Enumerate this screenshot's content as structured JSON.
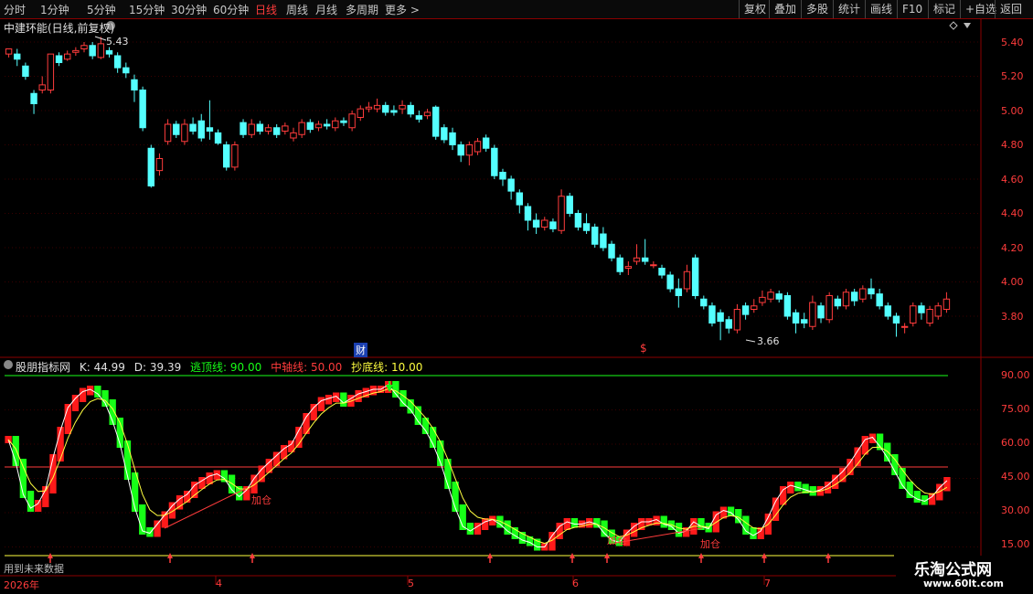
{
  "toolbar": {
    "periods": [
      "分时",
      "1分钟",
      "5分钟",
      "15分钟",
      "30分钟",
      "60分钟",
      "日线",
      "周线",
      "月线",
      "多周期",
      "更多 >"
    ],
    "active": "日线",
    "right_buttons": [
      "复权",
      "叠加",
      "多股",
      "统计",
      "画线",
      "F10",
      "标记",
      "+自选",
      "返回"
    ]
  },
  "main_panel": {
    "title": "中建环能(日线,前复权)",
    "price_axis": [
      "5.40",
      "5.20",
      "5.00",
      "4.80",
      "4.60",
      "4.40",
      "4.20",
      "4.00",
      "3.80"
    ],
    "high_label": "5.43",
    "low_label": "3.66",
    "event_marker": "财",
    "s_marker": "$"
  },
  "indicator_panel": {
    "name": "股朋指标网",
    "k_label": "K: 44.99",
    "d_label": "D: 39.39",
    "escape_top": "逃顶线: 90.00",
    "mid_axis": "中轴线: 50.00",
    "bottom_line": "抄底线: 10.00",
    "axis": [
      "90.00",
      "75.00",
      "60.00",
      "45.00",
      "30.00",
      "15.00"
    ],
    "add_labels": [
      "加仓",
      "加仓",
      "加仓"
    ],
    "future_note": "用到未来数据"
  },
  "date_axis": [
    "2026年",
    "4",
    "5",
    "6",
    "7"
  ],
  "watermark": {
    "title": "乐淘公式网",
    "url": "www.60lt.com"
  },
  "colors": {
    "up": "#ff3c3c",
    "down": "#54ffff",
    "k_up": "#ff1a1a",
    "k_down": "#17ff17",
    "border": "#8b0000"
  },
  "candles": [
    [
      5.33,
      5.36,
      5.31,
      5.34
    ],
    [
      5.33,
      5.3,
      5.26,
      5.36
    ],
    [
      5.26,
      5.2,
      5.18,
      5.28
    ],
    [
      5.1,
      5.04,
      4.98,
      5.12
    ],
    [
      5.12,
      5.15,
      5.1,
      5.2
    ],
    [
      5.12,
      5.33,
      5.1,
      5.33
    ],
    [
      5.32,
      5.28,
      5.26,
      5.34
    ],
    [
      5.3,
      5.33,
      5.29,
      5.35
    ],
    [
      5.34,
      5.35,
      5.32,
      5.37
    ],
    [
      5.36,
      5.38,
      5.34,
      5.4
    ],
    [
      5.38,
      5.32,
      5.3,
      5.4
    ],
    [
      5.31,
      5.39,
      5.3,
      5.43
    ],
    [
      5.35,
      5.33,
      5.31,
      5.37
    ],
    [
      5.32,
      5.25,
      5.22,
      5.34
    ],
    [
      5.25,
      5.22,
      5.19,
      5.28
    ],
    [
      5.18,
      5.12,
      5.05,
      5.21
    ],
    [
      5.12,
      4.9,
      4.88,
      5.14
    ],
    [
      4.78,
      4.56,
      4.55,
      4.8
    ],
    [
      4.65,
      4.72,
      4.62,
      4.75
    ],
    [
      4.82,
      4.92,
      4.8,
      4.95
    ],
    [
      4.92,
      4.86,
      4.84,
      4.94
    ],
    [
      4.82,
      4.92,
      4.8,
      4.95
    ],
    [
      4.92,
      4.88,
      4.86,
      4.96
    ],
    [
      4.94,
      4.84,
      4.82,
      4.98
    ],
    [
      4.9,
      4.88,
      4.83,
      5.06
    ],
    [
      4.87,
      4.81,
      4.8,
      4.89
    ],
    [
      4.8,
      4.67,
      4.65,
      4.82
    ],
    [
      4.67,
      4.8,
      4.65,
      4.82
    ],
    [
      4.93,
      4.86,
      4.84,
      4.95
    ],
    [
      4.86,
      4.92,
      4.84,
      4.95
    ],
    [
      4.92,
      4.88,
      4.86,
      4.94
    ],
    [
      4.88,
      4.9,
      4.86,
      4.92
    ],
    [
      4.9,
      4.86,
      4.84,
      4.92
    ],
    [
      4.88,
      4.91,
      4.86,
      4.93
    ],
    [
      4.84,
      4.87,
      4.82,
      4.9
    ],
    [
      4.86,
      4.93,
      4.84,
      4.95
    ],
    [
      4.93,
      4.89,
      4.87,
      4.95
    ],
    [
      4.9,
      4.92,
      4.88,
      4.94
    ],
    [
      4.92,
      4.91,
      4.89,
      4.95
    ],
    [
      4.9,
      4.94,
      4.88,
      4.96
    ],
    [
      4.94,
      4.93,
      4.91,
      4.96
    ],
    [
      4.9,
      4.98,
      4.88,
      5.0
    ],
    [
      4.96,
      5.01,
      4.94,
      5.03
    ],
    [
      5.01,
      5.02,
      4.99,
      5.05
    ],
    [
      5.01,
      5.03,
      4.99,
      5.07
    ],
    [
      5.03,
      4.99,
      4.97,
      5.05
    ],
    [
      5.0,
      4.99,
      4.97,
      5.03
    ],
    [
      5.01,
      5.03,
      4.98,
      5.06
    ],
    [
      5.03,
      4.98,
      4.96,
      5.05
    ],
    [
      4.97,
      4.95,
      4.93,
      5.0
    ],
    [
      4.97,
      4.99,
      4.95,
      5.01
    ],
    [
      5.02,
      4.85,
      4.83,
      5.03
    ],
    [
      4.9,
      4.83,
      4.81,
      4.92
    ],
    [
      4.87,
      4.8,
      4.77,
      4.9
    ],
    [
      4.8,
      4.74,
      4.7,
      4.82
    ],
    [
      4.74,
      4.8,
      4.68,
      4.82
    ],
    [
      4.76,
      4.82,
      4.74,
      4.84
    ],
    [
      4.84,
      4.78,
      4.76,
      4.86
    ],
    [
      4.78,
      4.62,
      4.6,
      4.8
    ],
    [
      4.64,
      4.6,
      4.56,
      4.66
    ],
    [
      4.6,
      4.53,
      4.48,
      4.62
    ],
    [
      4.52,
      4.45,
      4.4,
      4.54
    ],
    [
      4.44,
      4.36,
      4.3,
      4.46
    ],
    [
      4.36,
      4.32,
      4.28,
      4.4
    ],
    [
      4.32,
      4.36,
      4.3,
      4.38
    ],
    [
      4.35,
      4.31,
      4.29,
      4.37
    ],
    [
      4.3,
      4.5,
      4.28,
      4.54
    ],
    [
      4.5,
      4.4,
      4.38,
      4.52
    ],
    [
      4.4,
      4.32,
      4.3,
      4.42
    ],
    [
      4.34,
      4.3,
      4.28,
      4.4
    ],
    [
      4.32,
      4.22,
      4.2,
      4.34
    ],
    [
      4.28,
      4.2,
      4.18,
      4.32
    ],
    [
      4.22,
      4.14,
      4.12,
      4.24
    ],
    [
      4.14,
      4.06,
      4.04,
      4.16
    ],
    [
      4.08,
      4.09,
      4.04,
      4.12
    ],
    [
      4.12,
      4.14,
      4.1,
      4.22
    ],
    [
      4.14,
      4.12,
      4.1,
      4.25
    ],
    [
      4.1,
      4.1,
      4.08,
      4.12
    ],
    [
      4.08,
      4.04,
      4.02,
      4.1
    ],
    [
      4.04,
      3.96,
      3.94,
      4.06
    ],
    [
      3.96,
      3.92,
      3.85,
      4.02
    ],
    [
      3.96,
      4.06,
      3.94,
      4.1
    ],
    [
      4.14,
      3.92,
      3.9,
      4.16
    ],
    [
      3.9,
      3.86,
      3.84,
      3.92
    ],
    [
      3.86,
      3.76,
      3.74,
      3.88
    ],
    [
      3.82,
      3.77,
      3.66,
      3.84
    ],
    [
      3.78,
      3.73,
      3.7,
      3.8
    ],
    [
      3.72,
      3.84,
      3.7,
      3.87
    ],
    [
      3.86,
      3.81,
      3.78,
      3.88
    ],
    [
      3.84,
      3.86,
      3.82,
      3.9
    ],
    [
      3.88,
      3.91,
      3.86,
      3.95
    ],
    [
      3.9,
      3.94,
      3.88,
      3.96
    ],
    [
      3.93,
      3.9,
      3.88,
      3.95
    ],
    [
      3.92,
      3.8,
      3.78,
      3.94
    ],
    [
      3.82,
      3.76,
      3.7,
      3.84
    ],
    [
      3.78,
      3.76,
      3.73,
      3.82
    ],
    [
      3.74,
      3.88,
      3.72,
      3.92
    ],
    [
      3.86,
      3.79,
      3.76,
      3.88
    ],
    [
      3.78,
      3.92,
      3.76,
      3.94
    ],
    [
      3.9,
      3.86,
      3.84,
      3.92
    ],
    [
      3.86,
      3.94,
      3.84,
      3.96
    ],
    [
      3.94,
      3.89,
      3.86,
      3.96
    ],
    [
      3.9,
      3.96,
      3.88,
      3.98
    ],
    [
      3.96,
      3.93,
      3.9,
      4.02
    ],
    [
      3.93,
      3.86,
      3.84,
      3.96
    ],
    [
      3.86,
      3.8,
      3.78,
      3.88
    ],
    [
      3.8,
      3.76,
      3.68,
      3.82
    ],
    [
      3.74,
      3.74,
      3.7,
      3.76
    ],
    [
      3.76,
      3.86,
      3.74,
      3.88
    ],
    [
      3.86,
      3.82,
      3.78,
      3.88
    ],
    [
      3.76,
      3.84,
      3.74,
      3.86
    ],
    [
      3.8,
      3.86,
      3.78,
      3.88
    ],
    [
      3.84,
      3.9,
      3.82,
      3.94
    ]
  ],
  "k_values": [
    62,
    52,
    38,
    32,
    34,
    40,
    54,
    66,
    76,
    80,
    83,
    84,
    82,
    78,
    70,
    60,
    46,
    32,
    22,
    21,
    25,
    29,
    33,
    36,
    38,
    42,
    44,
    46,
    47,
    45,
    40,
    37,
    40,
    45,
    49,
    52,
    55,
    58,
    60,
    66,
    72,
    76,
    79,
    80,
    81,
    78,
    80,
    82,
    83,
    84,
    84,
    86,
    82,
    78,
    75,
    70,
    66,
    60,
    52,
    42,
    32,
    24,
    22,
    24,
    26,
    27,
    25,
    22,
    20,
    18,
    17,
    15,
    15,
    20,
    24,
    26,
    25,
    25,
    26,
    25,
    21,
    18,
    17,
    21,
    24,
    26,
    26,
    27,
    25,
    24,
    21,
    22,
    26,
    24,
    23,
    29,
    31,
    30,
    27,
    22,
    20,
    22,
    28,
    35,
    40,
    42,
    41,
    40,
    39,
    40,
    42,
    45,
    48,
    52,
    57,
    62,
    63,
    59,
    54,
    48,
    42,
    38,
    36,
    35,
    37,
    41,
    44
  ]
}
